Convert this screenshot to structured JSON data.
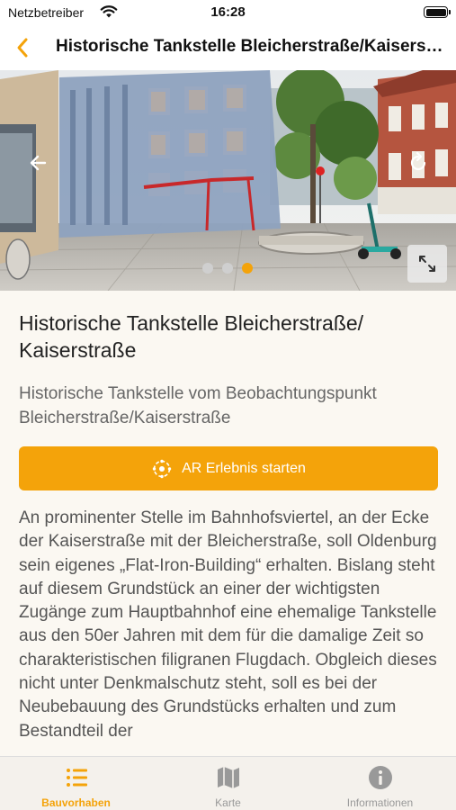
{
  "status_bar": {
    "carrier": "Netzbetreiber",
    "time": "16:28"
  },
  "nav": {
    "title": "Historische Tankstelle Bleicherstraße/Kaiserstraße"
  },
  "gallery": {
    "image_count": 3,
    "active_index": 2
  },
  "detail": {
    "title": "Historische Tankstelle Bleicherstraße/ Kaiserstraße",
    "subtitle": "Historische Tankstelle vom Beobachtungspunkt Bleicherstraße/Kaiserstraße",
    "ar_button_label": "AR Erlebnis starten",
    "description": "An prominenter Stelle im Bahnhofsviertel, an der Ecke der Kaiserstraße mit der Bleicherstraße, soll Oldenburg sein eigenes „Flat-Iron-Building“ erhalten. Bislang steht auf diesem Grundstück an einer der wichtigsten Zugänge zum Hauptbahnhof eine ehemalige Tankstelle aus den 50er Jahren mit dem für die damalige Zeit so charakteristischen filigranen Flugdach. Obgleich dieses nicht unter Denkmalschutz steht, soll es bei der Neubebauung des Grundstücks erhalten und zum Bestandteil der"
  },
  "tabs": [
    {
      "label": "Bauvorhaben",
      "icon": "list-icon",
      "active": true
    },
    {
      "label": "Karte",
      "icon": "map-icon",
      "active": false
    },
    {
      "label": "Informationen",
      "icon": "info-icon",
      "active": false
    }
  ],
  "colors": {
    "accent": "#f4a30a",
    "background": "#fbf8f2",
    "tab_inactive": "#999999"
  }
}
